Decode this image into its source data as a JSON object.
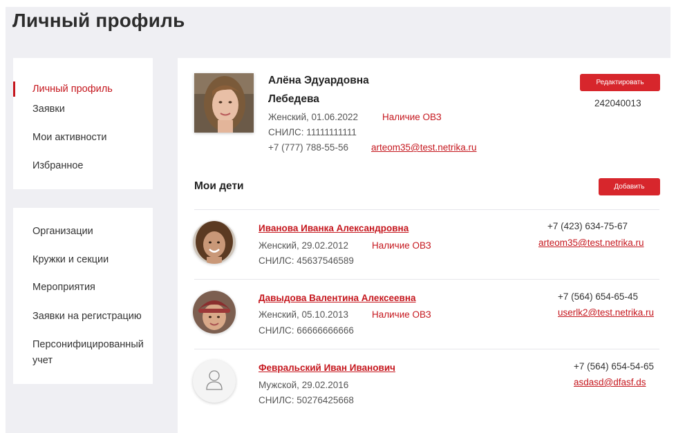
{
  "page": {
    "title": "Личный профиль"
  },
  "sidebar": {
    "group1": [
      {
        "label": "Личный профиль",
        "active": true
      },
      {
        "label": "Заявки",
        "active": false
      },
      {
        "label": "Мои активности",
        "active": false
      },
      {
        "label": "Избранное",
        "active": false
      }
    ],
    "group2": [
      {
        "label": "Организации"
      },
      {
        "label": "Кружки и секции"
      },
      {
        "label": "Мероприятия"
      },
      {
        "label": "Заявки на регистрацию"
      },
      {
        "label": "Персонифицированный"
      },
      {
        "label": "учет"
      }
    ]
  },
  "profile": {
    "name_line1": "Алёна Эдуардовна",
    "name_line2": "Лебедева",
    "gender_birth": "Женский, 01.06.2022",
    "ovz": "Наличие ОВЗ",
    "snils": "СНИЛС: 11111111111",
    "phone": "+7 (777) 788-55-56",
    "email": "arteom35@test.netrika.ru",
    "edit_button": "Редактировать",
    "id_number": "242040013"
  },
  "children_section": {
    "title": "Мои дети",
    "add_button": "Добавить",
    "items": [
      {
        "name": "Иванова Иванка Александровна",
        "gender_birth": "Женский, 29.02.2012",
        "ovz": "Наличие ОВЗ",
        "snils": "СНИЛС: 45637546589",
        "phone": "+7 (423) 634-75-67",
        "email": "arteom35@test.netrika.ru"
      },
      {
        "name": "Давыдова Валентина Алексеевна",
        "gender_birth": "Женский, 05.10.2013",
        "ovz": "Наличие ОВЗ",
        "snils": "СНИЛС: 66666666666",
        "phone": "+7 (564) 654-65-45",
        "email": "userlk2@test.netrika.ru"
      },
      {
        "name": "Февральский Иван Иванович",
        "gender_birth": "Мужской, 29.02.2016",
        "snils": "СНИЛС: 50276425668",
        "phone": "+7 (564) 654-54-65",
        "email": "asdasd@dfasf.ds"
      }
    ]
  },
  "colors": {
    "accent": "#c5161d",
    "button": "#d7262c",
    "background": "#efeff3"
  },
  "icons": {
    "placeholder_avatar": "user-outline-icon"
  }
}
